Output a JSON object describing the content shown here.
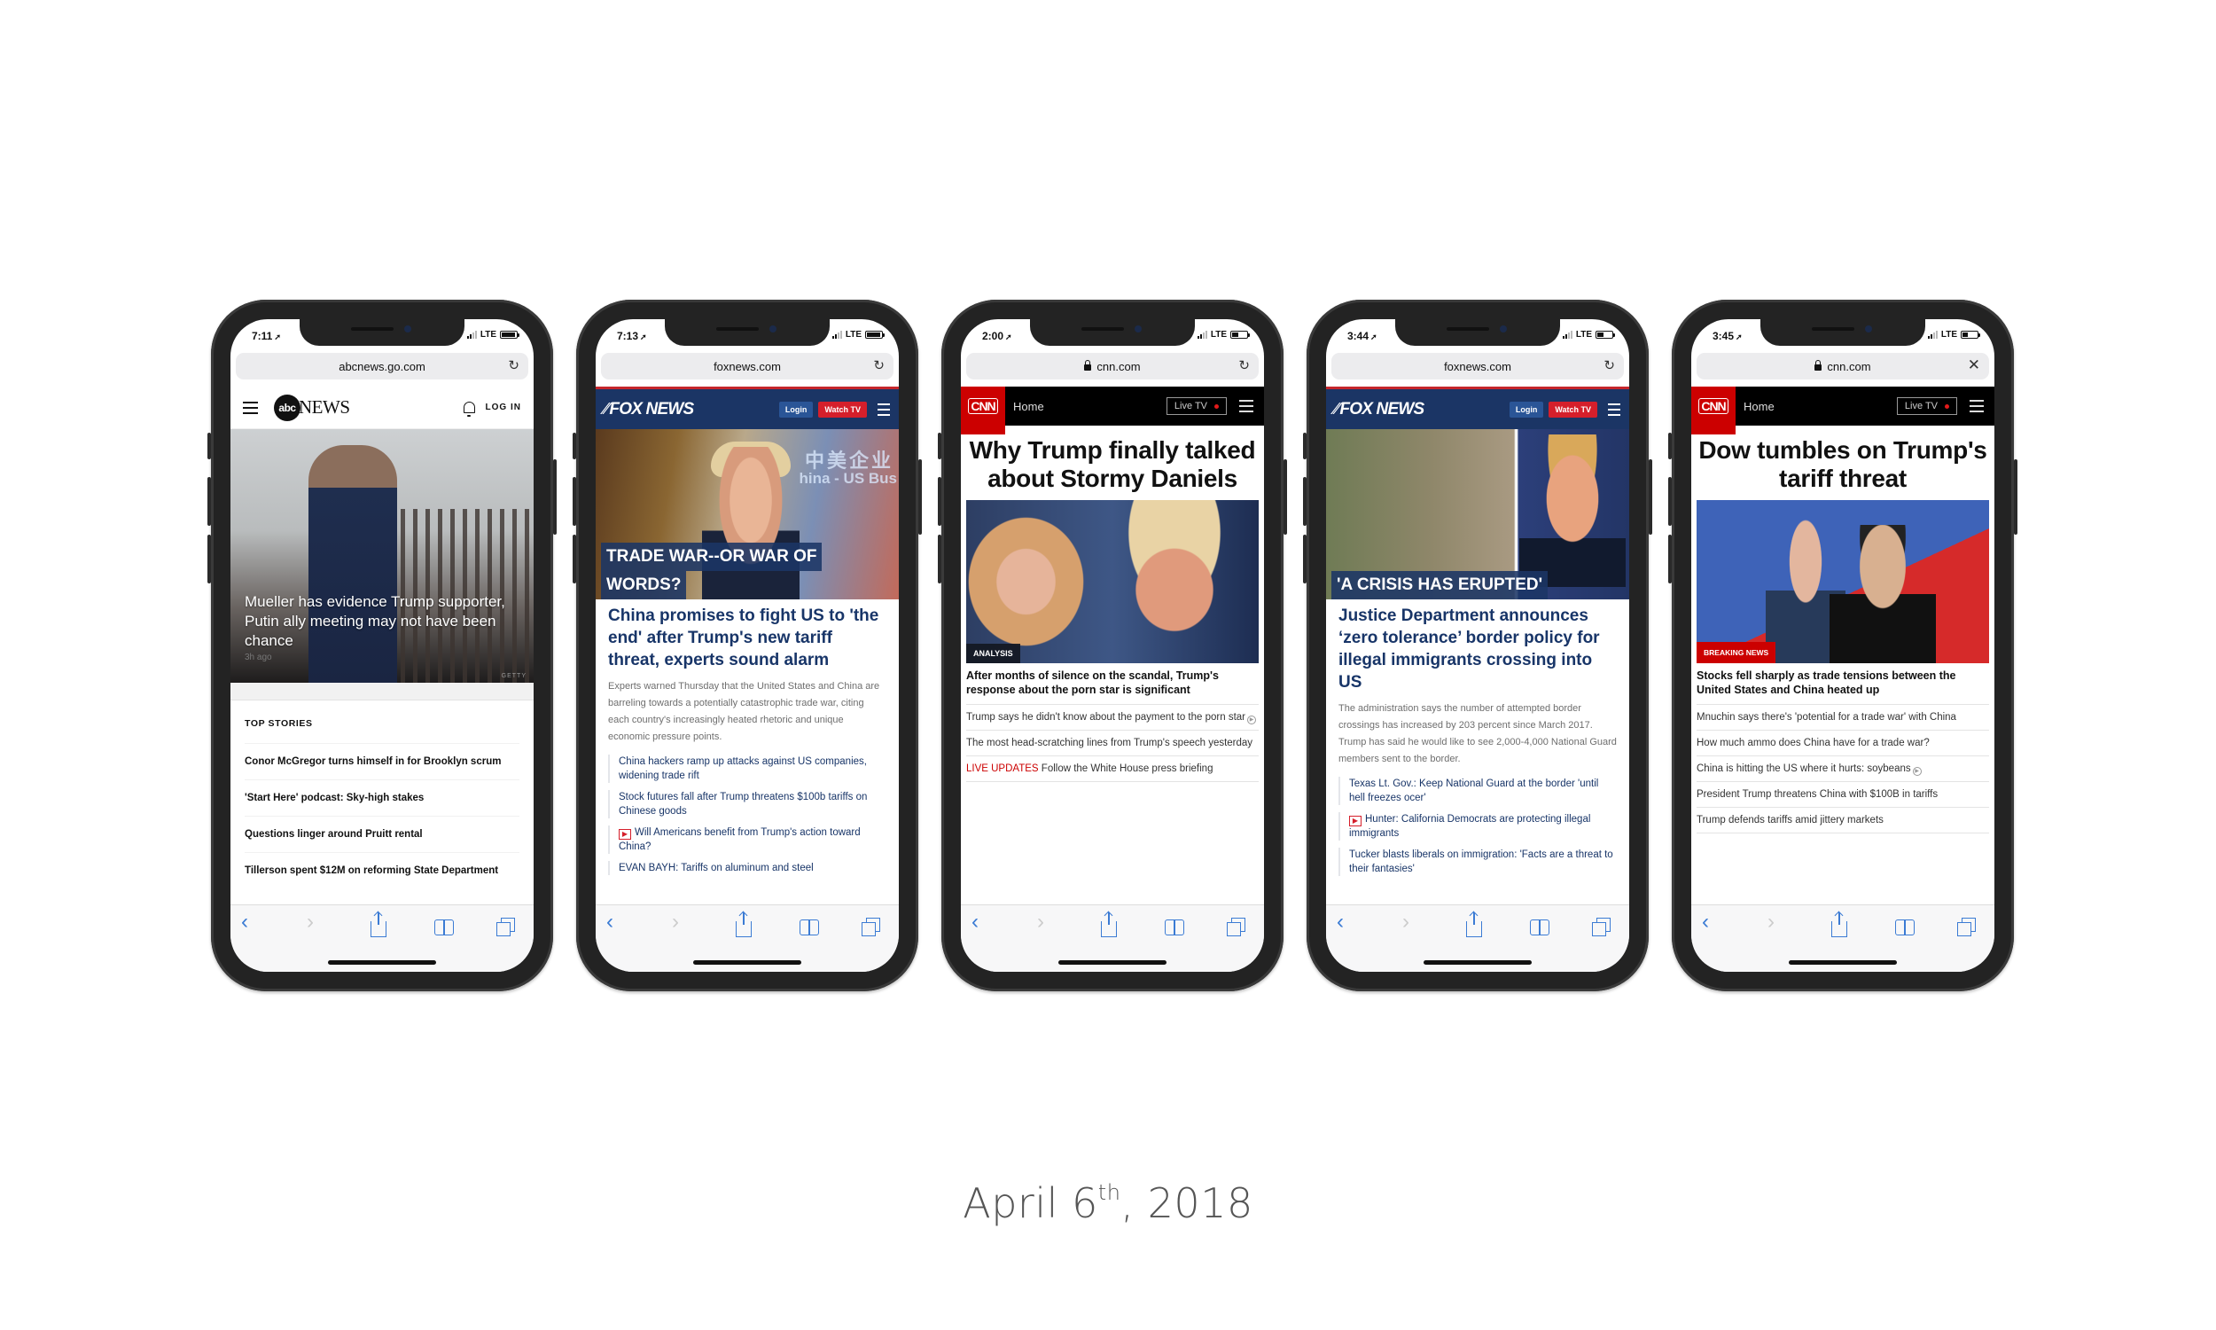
{
  "caption": {
    "prefix": "April 6",
    "suffix": "th",
    "rest": ", 2018"
  },
  "toolbar_icons": [
    "back-icon",
    "forward-icon",
    "share-icon",
    "bookmarks-icon",
    "tabs-icon"
  ],
  "phones": [
    {
      "site": "abc",
      "status": {
        "time": "7:11",
        "network": "LTE",
        "battery": 0.9
      },
      "url": "abcnews.go.com",
      "url_action": "reload",
      "nav": {
        "logo_mark": "abc",
        "logo_word": "NEWS",
        "login": "LOG IN"
      },
      "hero": {
        "headline": "Mueller has evidence Trump supporter, Putin ally meeting may not have been chance",
        "age": "3h ago",
        "credit": "GETTY"
      },
      "top_stories": {
        "heading": "TOP STORIES",
        "items": [
          "Conor McGregor turns himself in for Brooklyn scrum",
          "'Start Here' podcast: Sky-high stakes",
          "Questions linger around Pruitt rental",
          "Tillerson spent $12M on reforming State Department"
        ]
      }
    },
    {
      "site": "fox",
      "status": {
        "time": "7:13",
        "network": "LTE",
        "battery": 0.9
      },
      "url": "foxnews.com",
      "url_action": "reload",
      "nav": {
        "logo": "FOX NEWS",
        "login": "Login",
        "watch": "Watch TV"
      },
      "hero": {
        "banner_line1": "TRADE WAR--OR WAR OF",
        "banner_line2": "WORDS?",
        "image_text1": "中美企业",
        "image_text2": "hina - US Bus"
      },
      "headline": "China promises to fight US to 'the end' after Trump's new tariff threat, experts sound alarm",
      "dek": "Experts warned Thursday that the United States and China are barreling towards a potentially catastrophic trade war, citing each country's increasingly heated rhetoric and unique economic pressure points.",
      "related": [
        {
          "text": "China hackers ramp up attacks against US companies, widening trade rift",
          "video": false
        },
        {
          "text": "Stock futures fall after Trump threatens $100b tariffs on Chinese goods",
          "video": false
        },
        {
          "text": "Will Americans benefit from Trump's action toward China?",
          "video": true
        },
        {
          "text": "EVAN BAYH: Tariffs on aluminum and steel",
          "video": false
        }
      ]
    },
    {
      "site": "cnn",
      "status": {
        "time": "2:00",
        "network": "LTE",
        "battery": 0.4
      },
      "url": "cnn.com",
      "url_action": "reload",
      "secure": true,
      "nav": {
        "logo": "CNN",
        "home": "Home",
        "live": "Live TV"
      },
      "title": "Why Trump finally talked about Stormy Daniels",
      "image_tag": "ANALYSIS",
      "lead": "After months of silence on the scandal, Trump's response about the porn star is significant",
      "rows": [
        {
          "prefix": "",
          "text": "Trump says he didn't know about the payment to the porn star",
          "video": true
        },
        {
          "prefix": "",
          "text": "The most head-scratching lines from Trump's speech yesterday",
          "video": false
        },
        {
          "prefix": "LIVE UPDATES",
          "text": " Follow the White House press briefing",
          "video": false
        }
      ]
    },
    {
      "site": "fox",
      "status": {
        "time": "3:44",
        "network": "LTE",
        "battery": 0.4
      },
      "url": "foxnews.com",
      "url_action": "reload",
      "nav": {
        "logo": "FOX NEWS",
        "login": "Login",
        "watch": "Watch TV"
      },
      "hero": {
        "banner_line1": "'A CRISIS HAS ERUPTED'",
        "banner_line2": ""
      },
      "headline": "Justice Department announces ‘zero tolerance’ border policy for illegal immigrants crossing into US",
      "dek": "The administration says the number of attempted border crossings has increased by 203 percent since March 2017. Trump has said he would like to see 2,000-4,000 National Guard members sent to the border.",
      "related": [
        {
          "text": "Texas Lt. Gov.: Keep National Guard at the border 'until hell freezes ocer'",
          "video": false
        },
        {
          "text": "Hunter: California Democrats are protecting illegal immigrants",
          "video": true
        },
        {
          "text": "Tucker blasts liberals on immigration: 'Facts are a threat to their fantasies'",
          "video": false
        }
      ]
    },
    {
      "site": "cnn",
      "status": {
        "time": "3:45",
        "network": "LTE",
        "battery": 0.35
      },
      "url": "cnn.com",
      "url_action": "close",
      "secure": true,
      "nav": {
        "logo": "CNN",
        "home": "Home",
        "live": "Live TV"
      },
      "title": "Dow tumbles on Trump's tariff threat",
      "image_tag": "BREAKING NEWS",
      "lead": "Stocks fell sharply as trade tensions between the United States and China heated up",
      "rows": [
        {
          "prefix": "",
          "text": "Mnuchin says there's 'potential for a trade war' with China",
          "video": false
        },
        {
          "prefix": "",
          "text": "How much ammo does China have for a trade war?",
          "video": false
        },
        {
          "prefix": "",
          "text": "China is hitting the US where it hurts: soybeans",
          "video": true
        },
        {
          "prefix": "",
          "text": "President Trump threatens China with $100B in tariffs",
          "video": false
        },
        {
          "prefix": "",
          "text": "Trump defends tariffs amid jittery markets",
          "video": false
        }
      ]
    }
  ]
}
